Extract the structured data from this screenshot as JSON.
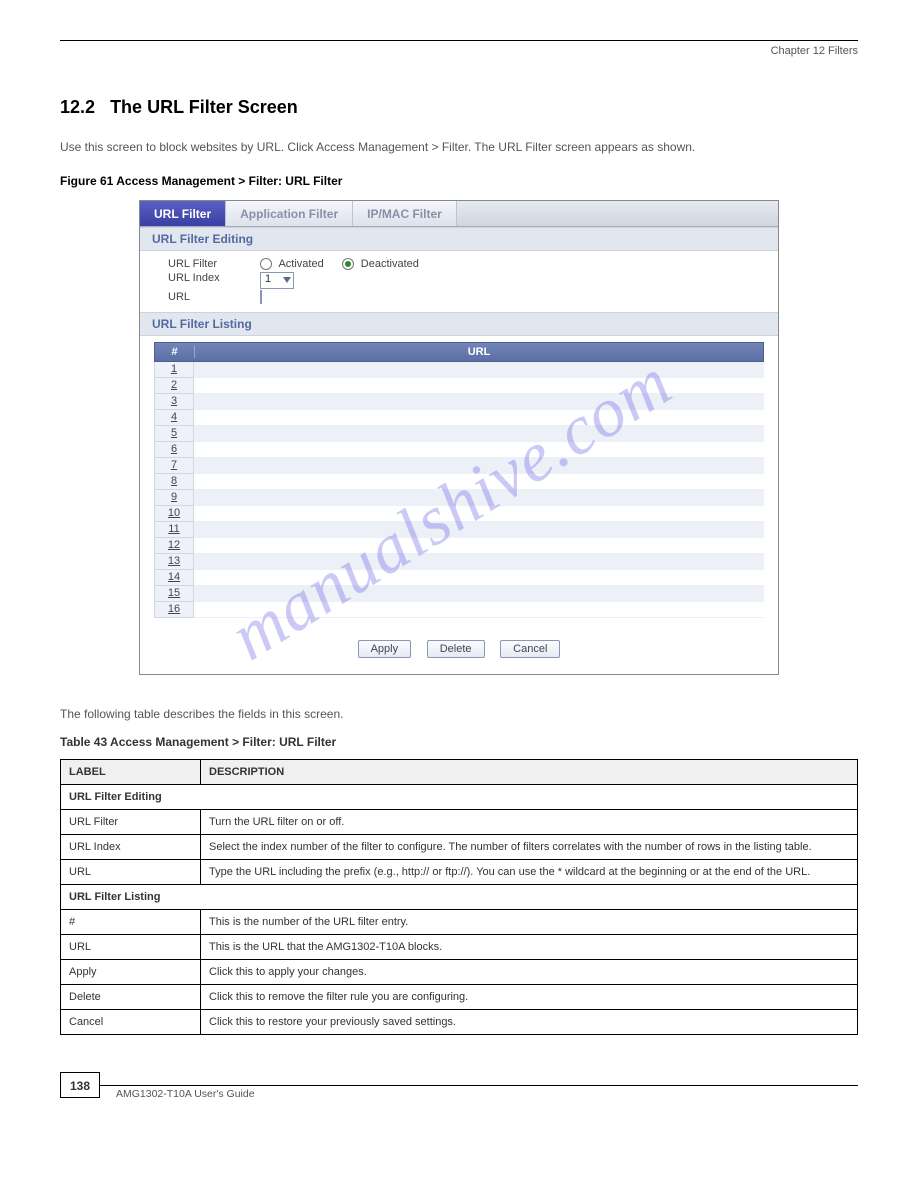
{
  "header": {
    "chapter_label": "Chapter 12 Filters",
    "section_number": "12.2",
    "section_title": "The URL Filter Screen"
  },
  "intro": "Use this screen to block websites by URL. Click Access Management > Filter. The URL Filter screen appears as shown.",
  "figure_label": "Figure 61 Access Management > Filter: URL Filter",
  "watermark": "manualshive.com",
  "tabs": [
    {
      "label": "URL Filter",
      "active": true
    },
    {
      "label": "Application Filter",
      "active": false
    },
    {
      "label": "IP/MAC Filter",
      "active": false
    }
  ],
  "section_editing": "URL Filter Editing",
  "section_listing": "URL Filter Listing",
  "form": {
    "url_filter_label": "URL Filter",
    "url_index_label": "URL Index",
    "url_label": "URL",
    "activated_label": "Activated",
    "deactivated_label": "Deactivated",
    "index_value": "1",
    "url_value": ""
  },
  "listing": {
    "col_idx": "#",
    "col_url": "URL",
    "rows": [
      1,
      2,
      3,
      4,
      5,
      6,
      7,
      8,
      9,
      10,
      11,
      12,
      13,
      14,
      15,
      16
    ]
  },
  "buttons": {
    "apply": "Apply",
    "delete": "Delete",
    "cancel": "Cancel"
  },
  "post_text": "The following table describes the fields in this screen.",
  "table_label": "Table 43 Access Management > Filter: URL Filter",
  "expl_table": {
    "head_label": "LABEL",
    "head_desc": "DESCRIPTION",
    "groups": [
      {
        "group": "URL Filter Editing",
        "rows": [
          {
            "label": "URL Filter",
            "desc": "Turn the URL filter on or off."
          },
          {
            "label": "URL Index",
            "desc": "Select the index number of the filter to configure. The number of filters correlates with the number of rows in the listing table."
          },
          {
            "label": "URL",
            "desc": "Type the URL including the prefix (e.g., http:// or ftp://). You can use the * wildcard at the beginning or at the end of the URL."
          }
        ]
      },
      {
        "group": "URL Filter Listing",
        "rows": [
          {
            "label": "#",
            "desc": "This is the number of the URL filter entry."
          },
          {
            "label": "URL",
            "desc": "This is the URL that the AMG1302-T10A blocks."
          },
          {
            "label": "Apply",
            "desc": "Click this to apply your changes."
          },
          {
            "label": "Delete",
            "desc": "Click this to remove the filter rule you are configuring."
          },
          {
            "label": "Cancel",
            "desc": "Click this to restore your previously saved settings."
          }
        ]
      }
    ]
  },
  "footer": {
    "page": "138",
    "guide": "AMG1302-T10A User's Guide"
  }
}
